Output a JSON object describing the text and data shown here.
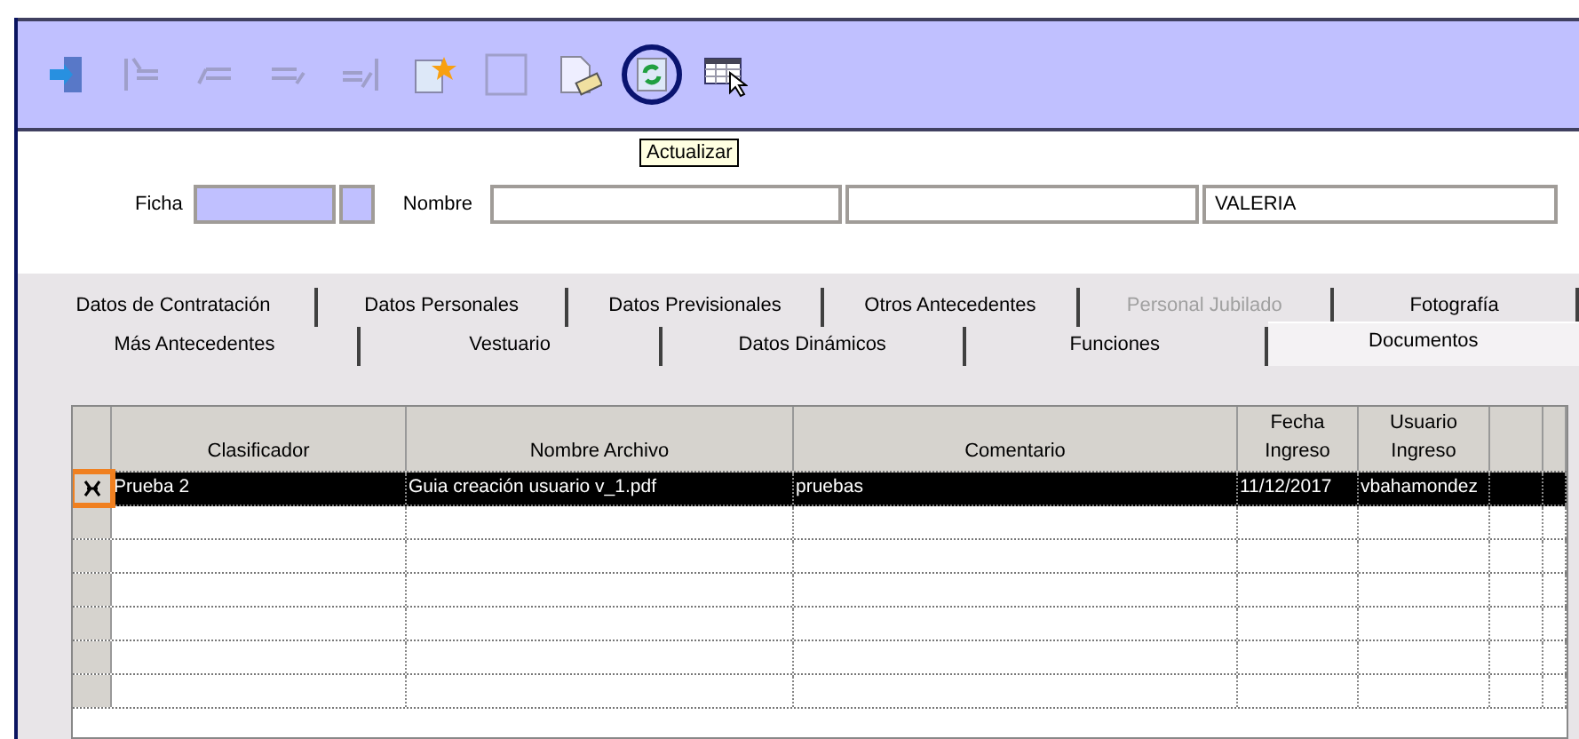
{
  "toolbar": {
    "items": [
      {
        "kind": "exit",
        "disabled": false,
        "highlighted": false
      },
      {
        "kind": "first",
        "disabled": true,
        "highlighted": false
      },
      {
        "kind": "previous",
        "disabled": true,
        "highlighted": false
      },
      {
        "kind": "next",
        "disabled": true,
        "highlighted": false
      },
      {
        "kind": "last",
        "disabled": true,
        "highlighted": false
      },
      {
        "kind": "new",
        "disabled": false,
        "highlighted": false
      },
      {
        "kind": "blank",
        "disabled": true,
        "highlighted": false
      },
      {
        "kind": "erase",
        "disabled": false,
        "highlighted": false
      },
      {
        "kind": "refresh",
        "disabled": false,
        "highlighted": true
      },
      {
        "kind": "grid",
        "disabled": false,
        "highlighted": false
      }
    ],
    "tooltip": "Actualizar"
  },
  "form": {
    "ficha_label": "Ficha",
    "nombre_label": "Nombre",
    "nombre_3": "VALERIA"
  },
  "tabs": [
    [
      {
        "label": "Datos de Contratación",
        "selected": false,
        "disabled": false
      },
      {
        "label": "Datos Personales",
        "selected": false,
        "disabled": false
      },
      {
        "label": "Datos Previsionales",
        "selected": false,
        "disabled": false
      },
      {
        "label": "Otros Antecedentes",
        "selected": false,
        "disabled": false
      },
      {
        "label": "Personal Jubilado",
        "selected": false,
        "disabled": true
      },
      {
        "label": "Fotografía",
        "selected": false,
        "disabled": false
      }
    ],
    [
      {
        "label": "Más Antecedentes",
        "selected": false,
        "disabled": false
      },
      {
        "label": "Vestuario",
        "selected": false,
        "disabled": false
      },
      {
        "label": "Datos Dinámicos",
        "selected": false,
        "disabled": false
      },
      {
        "label": "Funciones",
        "selected": false,
        "disabled": false
      },
      {
        "label": "Documentos",
        "selected": true,
        "disabled": false
      }
    ]
  ],
  "table": {
    "columns": [
      "Clasificador",
      "Nombre Archivo",
      "Comentario",
      "Fecha Ingreso",
      "Usuario Ingreso"
    ],
    "rows": [
      {
        "cells": [
          "Prueba 2",
          "Guia creación usuario v_1.pdf",
          "pruebas",
          "11/12/2017",
          "vbahamondez"
        ],
        "selected": true,
        "marker_highlighted": true
      }
    ]
  }
}
